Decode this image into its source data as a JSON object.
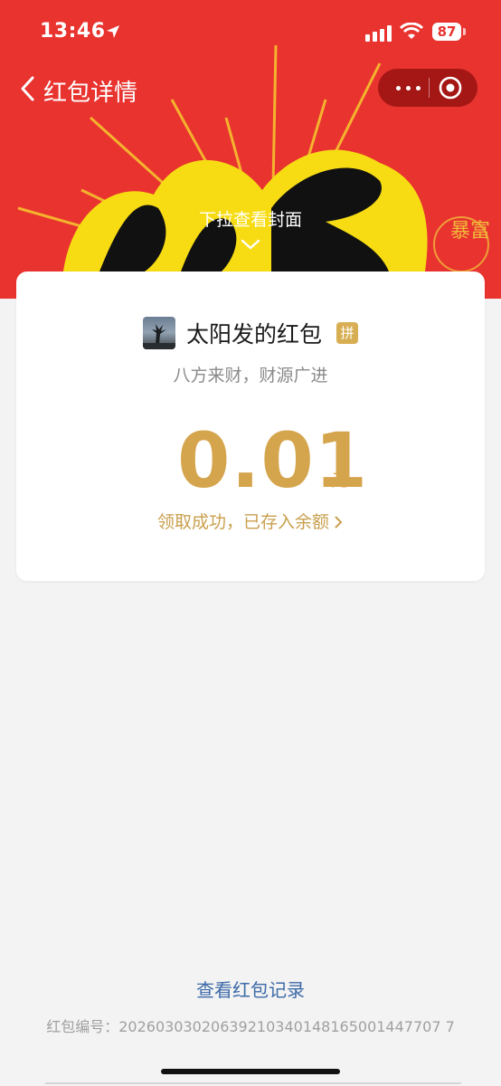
{
  "status_bar": {
    "time": "13:46",
    "battery": "87"
  },
  "nav": {
    "title": "红包详情"
  },
  "cover": {
    "hint": "下拉查看封面",
    "stamp_text": "暴富"
  },
  "packet": {
    "sender": "太阳发的红包",
    "badge": "拼",
    "wish": "八方来财，财源广进",
    "amount": "0.01",
    "unit": "元",
    "status": "领取成功，已存入余额"
  },
  "footer": {
    "records_link": "查看红包记录",
    "serial_label": "红包编号：",
    "serial_number": "20260303020639210340148165001447707 7"
  },
  "colors": {
    "red": "#e8332f",
    "gold": "#d5a54d",
    "link": "#3d6aa8"
  }
}
